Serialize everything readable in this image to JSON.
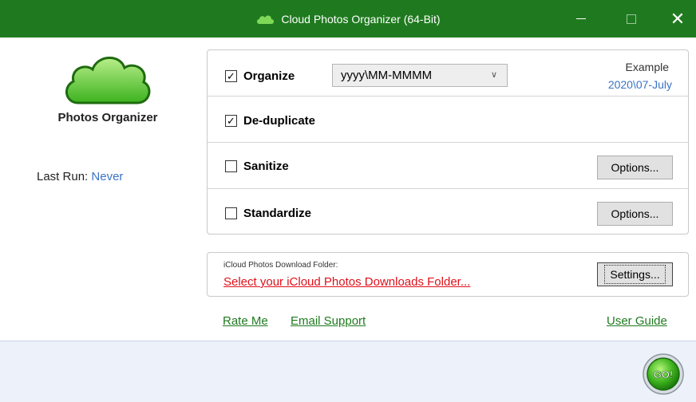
{
  "window": {
    "title": "Cloud Photos Organizer (64-Bit)",
    "minimize_glyph": "—",
    "close_glyph": "✕"
  },
  "app": {
    "name": "Photos Organizer",
    "last_run_label": "Last Run:",
    "last_run_value": "Never"
  },
  "options": {
    "organize": {
      "label": "Organize",
      "checked": true,
      "format_value": "yyyy\\MM-MMMM",
      "example_title": "Example",
      "example_value": "2020\\07-July"
    },
    "deduplicate": {
      "label": "De-duplicate",
      "checked": true
    },
    "sanitize": {
      "label": "Sanitize",
      "checked": false,
      "button": "Options..."
    },
    "standardize": {
      "label": "Standardize",
      "checked": false,
      "button": "Options..."
    }
  },
  "folder": {
    "label": "iCloud Photos Download Folder:",
    "link": "Select your iCloud Photos Downloads Folder...",
    "button": "Settings..."
  },
  "links": {
    "rate": "Rate Me",
    "email": "Email Support",
    "guide": "User Guide"
  },
  "go_button": {
    "label": "GO!"
  },
  "colors": {
    "titlebar": "#1f7a1f",
    "link_green": "#1f7a1f",
    "accent_blue": "#3a74c4",
    "error_red": "#e0101a"
  },
  "icons": {
    "title": "cloud-icon",
    "logo": "cloud-logo-icon",
    "check": "checkmark-icon",
    "dropdown": "chevron-down-icon"
  }
}
